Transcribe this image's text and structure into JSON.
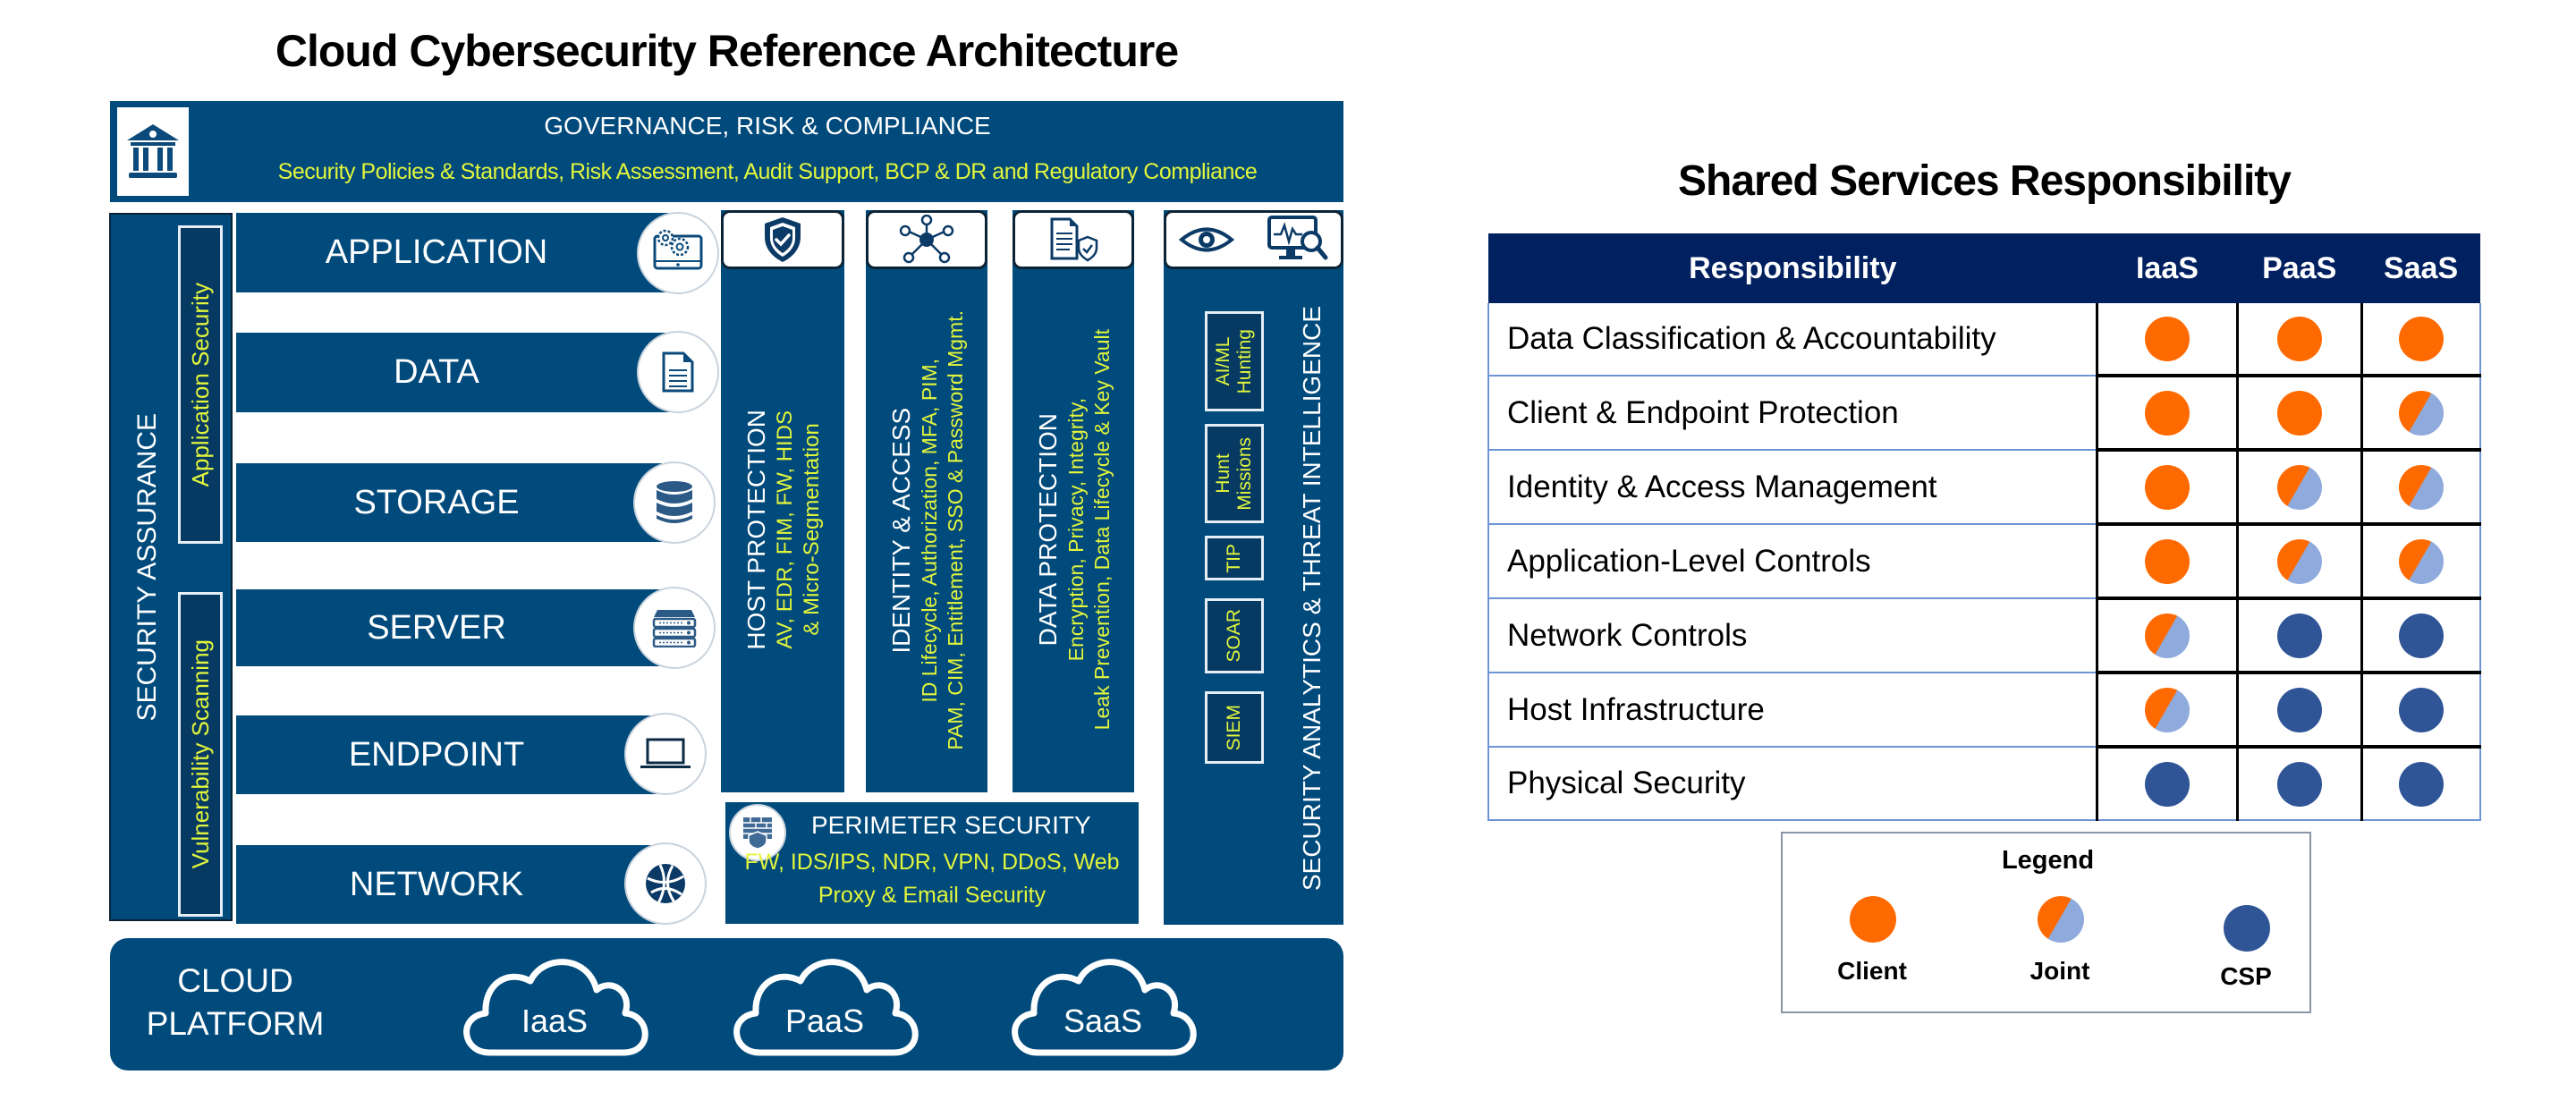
{
  "architecture": {
    "title": "Cloud Cybersecurity Reference Architecture",
    "grc": {
      "icon": "bank-building-icon",
      "title": "GOVERNANCE,  RISK & COMPLIANCE",
      "subtitle": "Security Policies & Standards, Risk Assessment, Audit Support, BCP & DR and Regulatory Compliance"
    },
    "security_assurance": {
      "title": "SECURITY ASSURANCE",
      "items": [
        "Application Security",
        "Vulnerability Scanning"
      ]
    },
    "layers": [
      {
        "label": "APPLICATION",
        "icon": "gears-monitor-icon"
      },
      {
        "label": "DATA",
        "icon": "document-icon"
      },
      {
        "label": "STORAGE",
        "icon": "database-icon"
      },
      {
        "label": "SERVER",
        "icon": "server-rack-icon"
      },
      {
        "label": "ENDPOINT",
        "icon": "laptop-icon"
      },
      {
        "label": "NETWORK",
        "icon": "globe-network-icon"
      }
    ],
    "columns": [
      {
        "title": "HOST PROTECTION",
        "lines": [
          "AV, EDR, FIM, FW, HIDS",
          "&  Micro-Segmentation"
        ],
        "icon": "shield-check-icon"
      },
      {
        "title": "IDENTITY & ACCESS",
        "lines": [
          "ID Lifecycle, Authorization, MFA, PIM,",
          "PAM, CIM,  Entitlement, SSO & Password Mgmt."
        ],
        "icon": "identity-network-icon"
      },
      {
        "title": "DATA PROTECTION",
        "lines": [
          "Encryption, Privacy, Integrity,",
          "Leak Prevention, Data Lifecycle & Key Vault"
        ],
        "icon": "document-shield-icon"
      }
    ],
    "perimeter": {
      "icon": "firewall-icon",
      "title": "PERIMETER SECURITY",
      "lines": [
        "FW, IDS/IPS, NDR, VPN, DDoS,  Web",
        "Proxy & Email Security"
      ]
    },
    "analytics": {
      "title": "SECURITY ANALYTICS & THREAT INTELLIGENCE",
      "icons": [
        "eye-icon",
        "monitor-search-icon"
      ],
      "items": [
        {
          "lines": [
            "AI/ML",
            "Hunting"
          ]
        },
        {
          "lines": [
            "Hunt",
            "Missions"
          ]
        },
        {
          "lines": [
            "TIP"
          ]
        },
        {
          "lines": [
            "SOAR"
          ]
        },
        {
          "lines": [
            "SIEM"
          ]
        }
      ]
    },
    "cloud_platform": {
      "title_lines": [
        "CLOUD",
        "PLATFORM"
      ],
      "clouds": [
        "IaaS",
        "PaaS",
        "SaaS"
      ]
    }
  },
  "responsibility": {
    "title": "Shared Services Responsibility",
    "headers": [
      "Responsibility",
      "IaaS",
      "PaaS",
      "SaaS"
    ],
    "rows": [
      {
        "label": "Data Classification & Accountability",
        "values": [
          "client",
          "client",
          "client"
        ]
      },
      {
        "label": "Client & Endpoint Protection",
        "values": [
          "client",
          "client",
          "joint"
        ]
      },
      {
        "label": "Identity & Access Management",
        "values": [
          "client",
          "joint",
          "joint"
        ]
      },
      {
        "label": "Application-Level Controls",
        "values": [
          "client",
          "joint",
          "joint"
        ]
      },
      {
        "label": "Network Controls",
        "values": [
          "joint",
          "csp",
          "csp"
        ]
      },
      {
        "label": "Host Infrastructure",
        "values": [
          "joint",
          "csp",
          "csp"
        ]
      },
      {
        "label": "Physical Security",
        "values": [
          "csp",
          "csp",
          "csp"
        ]
      }
    ],
    "legend": {
      "title": "Legend",
      "items": [
        {
          "key": "client",
          "label": "Client"
        },
        {
          "key": "joint",
          "label": "Joint"
        },
        {
          "key": "csp",
          "label": "CSP"
        }
      ]
    },
    "colors": {
      "client": "#FF6A00",
      "joint_light": "#8FAADC",
      "csp": "#2F5597",
      "header": "#002060",
      "panel": "#004A7C",
      "highlight_text": "#E2F53C"
    }
  }
}
